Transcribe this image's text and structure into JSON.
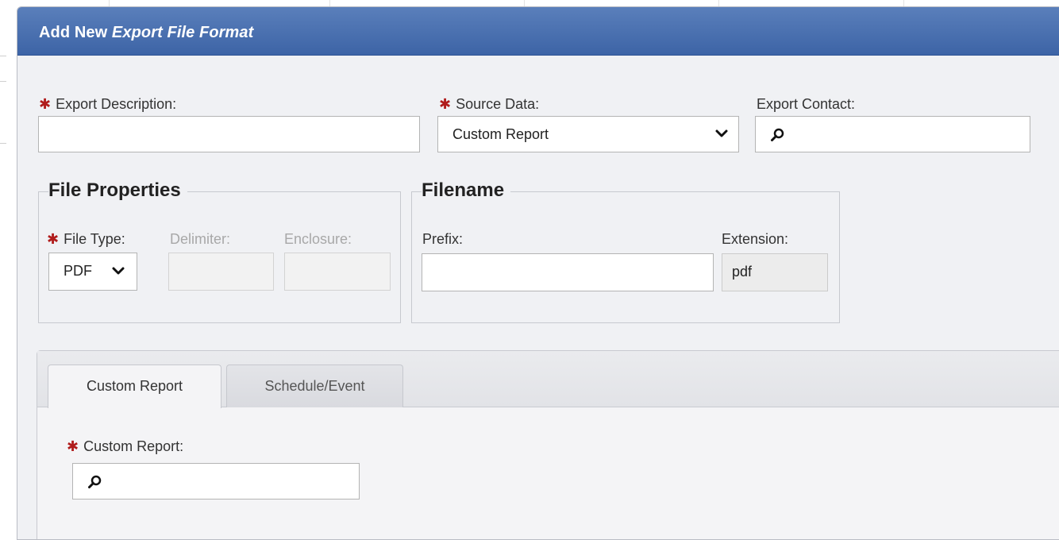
{
  "dialog": {
    "title_prefix": "Add New ",
    "title_italic": "Export File Format"
  },
  "fields": {
    "export_description": {
      "label": "Export Description:",
      "value": ""
    },
    "source_data": {
      "label": "Source Data:",
      "value": "Custom Report"
    },
    "export_contact": {
      "label": "Export Contact:",
      "value": ""
    }
  },
  "file_properties": {
    "legend": "File Properties",
    "file_type": {
      "label": "File Type:",
      "value": "PDF"
    },
    "delimiter": {
      "label": "Delimiter:",
      "value": ""
    },
    "enclosure": {
      "label": "Enclosure:",
      "value": ""
    }
  },
  "filename": {
    "legend": "Filename",
    "prefix": {
      "label": "Prefix:",
      "value": ""
    },
    "extension": {
      "label": "Extension:",
      "value": "pdf"
    }
  },
  "tabs": [
    {
      "label": "Custom Report",
      "active": true
    },
    {
      "label": "Schedule/Event",
      "active": false
    }
  ],
  "custom_report": {
    "label": "Custom Report:",
    "value": ""
  },
  "required_marker": "✱",
  "icons": {
    "lookup": "magnifier-icon",
    "dropdown": "chevron-down-icon"
  },
  "colors": {
    "titlebar": "#4a70b0",
    "required": "#b01c1c"
  }
}
